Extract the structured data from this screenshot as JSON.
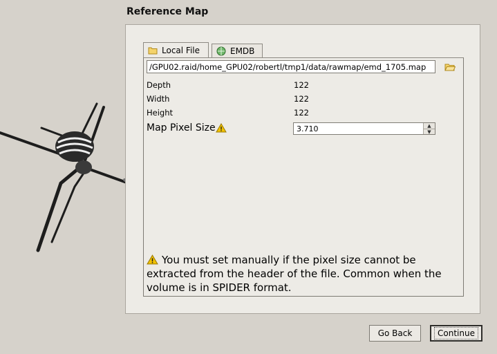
{
  "window": {
    "title": "Reference Map"
  },
  "tabs": [
    {
      "label": "Local File",
      "icon": "folder-icon",
      "active": true
    },
    {
      "label": "EMDB",
      "icon": "emdb-globe-icon",
      "active": false
    }
  ],
  "file": {
    "path": "/GPU02.raid/home_GPU02/robertl/tmp1/data/rawmap/emd_1705.map",
    "browse_icon": "folder-open-icon"
  },
  "properties": [
    {
      "label": "Depth",
      "value": "122"
    },
    {
      "label": "Width",
      "value": "122"
    },
    {
      "label": "Height",
      "value": "122"
    }
  ],
  "pixel_size": {
    "label": "Map Pixel Size",
    "value": "3.710",
    "warning_icon": "warning-icon"
  },
  "note": {
    "text": "You must set manually if the pixel size cannot be extracted from the header of the file. Common when the volume is in SPIDER format."
  },
  "buttons": {
    "back": "Go Back",
    "continue": "Continue"
  },
  "colors": {
    "background": "#d6d2cb",
    "panel": "#edebe6",
    "warning": "#f2c200"
  }
}
